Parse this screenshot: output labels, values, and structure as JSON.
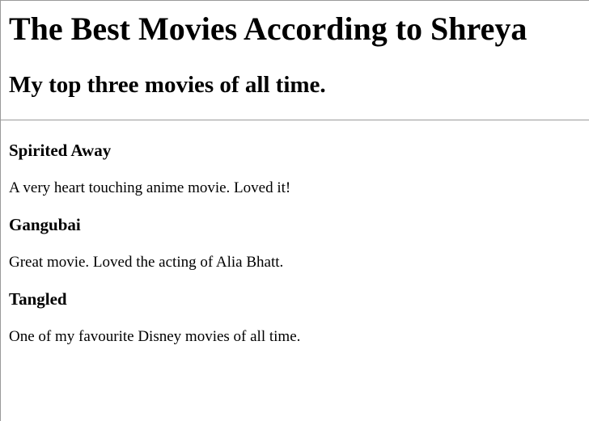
{
  "page": {
    "heading": "The Best Movies According to Shreya",
    "subheading": "My top three movies of all time."
  },
  "movies": [
    {
      "title": "Spirited Away",
      "description": "A very heart touching anime movie. Loved it!"
    },
    {
      "title": "Gangubai",
      "description": "Great movie. Loved the acting of Alia Bhatt."
    },
    {
      "title": "Tangled",
      "description": "One of my favourite Disney movies of all time."
    }
  ]
}
